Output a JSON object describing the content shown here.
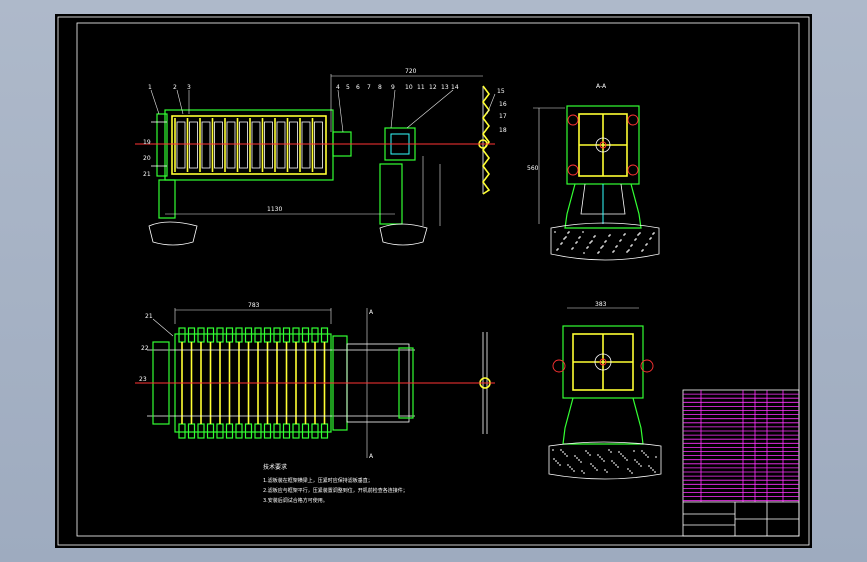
{
  "drawing": {
    "dimensions": {
      "top_width": "720",
      "frame_length": "1130",
      "right_height": "560",
      "lower_width": "783",
      "lower_right_width": "383"
    },
    "section_labels": {
      "top_right": "A-A",
      "section_mark_top": "A",
      "section_mark_bottom": "A"
    },
    "part_numbers_top": [
      "1",
      "2",
      "3",
      "4",
      "5",
      "6",
      "7",
      "8",
      "9",
      "10",
      "11",
      "12",
      "13",
      "14",
      "15",
      "16",
      "17",
      "18",
      "19",
      "20",
      "21"
    ],
    "part_numbers_lower": [
      "21",
      "22",
      "23"
    ],
    "tech_requirements": {
      "title": "技术要求",
      "lines": [
        "1.滤板装在框架横梁上，压紧时应保持滤板垂直；",
        "2.滤板应与框架平行，压紧装置调整到位，开机前检查各连接件；",
        "3.安装后调试合格方可使用。"
      ]
    }
  },
  "colors": {
    "frame": "#ffffff",
    "part_green": "#33ff33",
    "plate_yellow": "#ffff33",
    "axis_red": "#ff3333",
    "cyan": "#33ffff",
    "table_magenta": "#ff33ff"
  }
}
